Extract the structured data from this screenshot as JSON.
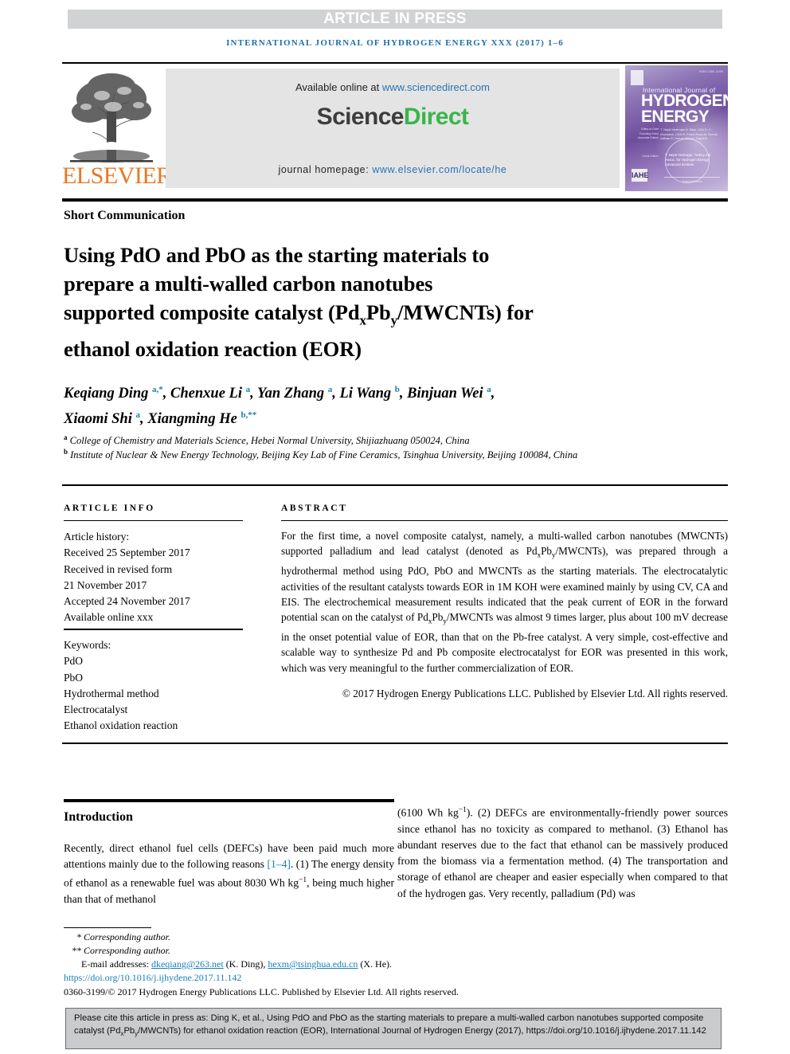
{
  "banner": {
    "article_in_press": "ARTICLE IN PRESS",
    "journal_line": "INTERNATIONAL JOURNAL OF HYDROGEN ENERGY XXX (2017) 1–6"
  },
  "masthead": {
    "elsevier_wordmark": "ELSEVIER",
    "available_prefix": "Available online at ",
    "available_url": "www.sciencedirect.com",
    "sciencedirect_part1": "Science",
    "sciencedirect_part2": "Direct",
    "homepage_prefix": "journal homepage: ",
    "homepage_url": "www.elsevier.com/locate/he",
    "cover": {
      "issn": "ISSN 0360-3199",
      "line1": "International Journal of",
      "line2": "HYDROGEN",
      "line3": "ENERGY",
      "label_block_1": "Editor-in-Chief\nFounding Editor\nAssociate Editors",
      "names_block_1": "T. Nejat Veziroglu\nA. Bilgi, USA\nD. Y. Goswami, USA\nR. Frank Ross\nM. Kemal Atilhan\nE. Kemal Atilhan, Canada",
      "label_block_2": "Guest Editors",
      "names_block_2": "T. Nejat Veziroglu, Turkey\nIntl. Assoc. for Hydrogen Energy\nAdvanced Institute",
      "badge": "IAHE",
      "footer": "ScienceDirect"
    }
  },
  "article": {
    "type": "Short Communication",
    "title_line1": "Using PdO and PbO as the starting materials to",
    "title_line2": "prepare a multi-walled carbon nanotubes",
    "title_line3_a": "supported composite catalyst (Pd",
    "title_line3_sub1": "x",
    "title_line3_b": "Pb",
    "title_line3_sub2": "y",
    "title_line3_c": "/MWCNTs) for",
    "title_line4": "ethanol oxidation reaction (EOR)"
  },
  "authors": {
    "line1": "Keqiang Ding",
    "list": "Keqiang Ding a,*, Chenxue Li a, Yan Zhang a, Li Wang b, Binjuan Wei a, Xiaomi Shi a, Xiangming He b,**",
    "affil_a": "College of Chemistry and Materials Science, Hebei Normal University, Shijiazhuang 050024, China",
    "affil_b": "Institute of Nuclear & New Energy Technology, Beijing Key Lab of Fine Ceramics, Tsinghua University, Beijing 100084, China"
  },
  "article_info": {
    "heading": "ARTICLE INFO",
    "history_label": "Article history:",
    "received": "Received 25 September 2017",
    "revised_label": "Received in revised form",
    "revised_date": "21 November 2017",
    "accepted": "Accepted 24 November 2017",
    "available_online": "Available online xxx",
    "keywords_label": "Keywords:",
    "keywords": [
      "PdO",
      "PbO",
      "Hydrothermal method",
      "Electrocatalyst",
      "Ethanol oxidation reaction"
    ]
  },
  "abstract": {
    "heading": "ABSTRACT",
    "text_part1": "For the first time, a novel composite catalyst, namely, a multi-walled carbon nanotubes (MWCNTs) supported palladium and lead catalyst (denoted as Pd",
    "sub_x": "x",
    "text_part2": "Pb",
    "sub_y": "y",
    "text_part3": "/MWCNTs), was prepared through a hydrothermal method using PdO, PbO and MWCNTs as the starting materials. The electrocatalytic activities of the resultant catalysts towards EOR in 1M KOH were examined mainly by using CV, CA and EIS. The electrochemical measurement results indicated that the peak current of EOR in the forward potential scan on the catalyst of Pd",
    "sub_x2": "x",
    "text_part4": "Pb",
    "sub_y2": "y",
    "text_part5": "/MWCNTs was almost 9 times larger, plus about 100 mV decrease in the onset potential value of EOR, than that on the Pb-free catalyst. A very simple, cost-effective and scalable way to synthesize Pd and Pb composite electrocatalyst for EOR was presented in this work, which was very meaningful to the further commercialization of EOR.",
    "copyright": "© 2017 Hydrogen Energy Publications LLC. Published by Elsevier Ltd. All rights reserved."
  },
  "body": {
    "intro_heading": "Introduction",
    "left_col_a": "Recently, direct ethanol fuel cells (DEFCs) have been paid much more attentions mainly due to the following reasons ",
    "left_col_ref": "[1–4]",
    "left_col_b": ". (1) The energy density of ethanol as a renewable fuel was about 8030 Wh kg",
    "left_col_sup": "−1",
    "left_col_c": ", being much higher than that of methanol",
    "right_col_a": "(6100 Wh kg",
    "right_col_sup": "−1",
    "right_col_b": "). (2) DEFCs are environmentally-friendly power sources since ethanol has no toxicity as compared to methanol. (3) Ethanol has abundant reserves due to the fact that ethanol can be massively produced from the biomass via a fermentation method. (4) The transportation and storage of ethanol are cheaper and easier especially when compared to that of the hydrogen gas. Very recently, palladium (Pd) was"
  },
  "footnotes": {
    "fn1": "* Corresponding author.",
    "fn2": "** Corresponding author.",
    "email_label": "E-mail addresses: ",
    "email1": "dkeqiang@263.net",
    "email1_who": " (K. Ding), ",
    "email2": "hexm@tsinghua.edu.cn",
    "email2_who": " (X. He).",
    "doi": "https://doi.org/10.1016/j.ijhydene.2017.11.142",
    "issn_line": "0360-3199/© 2017 Hydrogen Energy Publications LLC. Published by Elsevier Ltd. All rights reserved."
  },
  "citation_box": {
    "part1": "Please cite this article in press as: Ding K, et al., Using PdO and PbO as the starting materials to prepare a multi-walled carbon nanotubes supported composite catalyst (Pd",
    "sub_x": "x",
    "part2": "Pb",
    "sub_y": "y",
    "part3": "/MWCNTs) for ethanol oxidation reaction (EOR), International Journal of Hydrogen Energy (2017), https://doi.org/10.1016/j.ijhydene.2017.11.142"
  },
  "colors": {
    "link_blue": "#1a7fb5",
    "sciencedirect_green": "#39b54a",
    "elsevier_orange": "#e87722",
    "banner_gray": "#d0d2d4",
    "cite_box_gray": "#c9cbcd"
  }
}
